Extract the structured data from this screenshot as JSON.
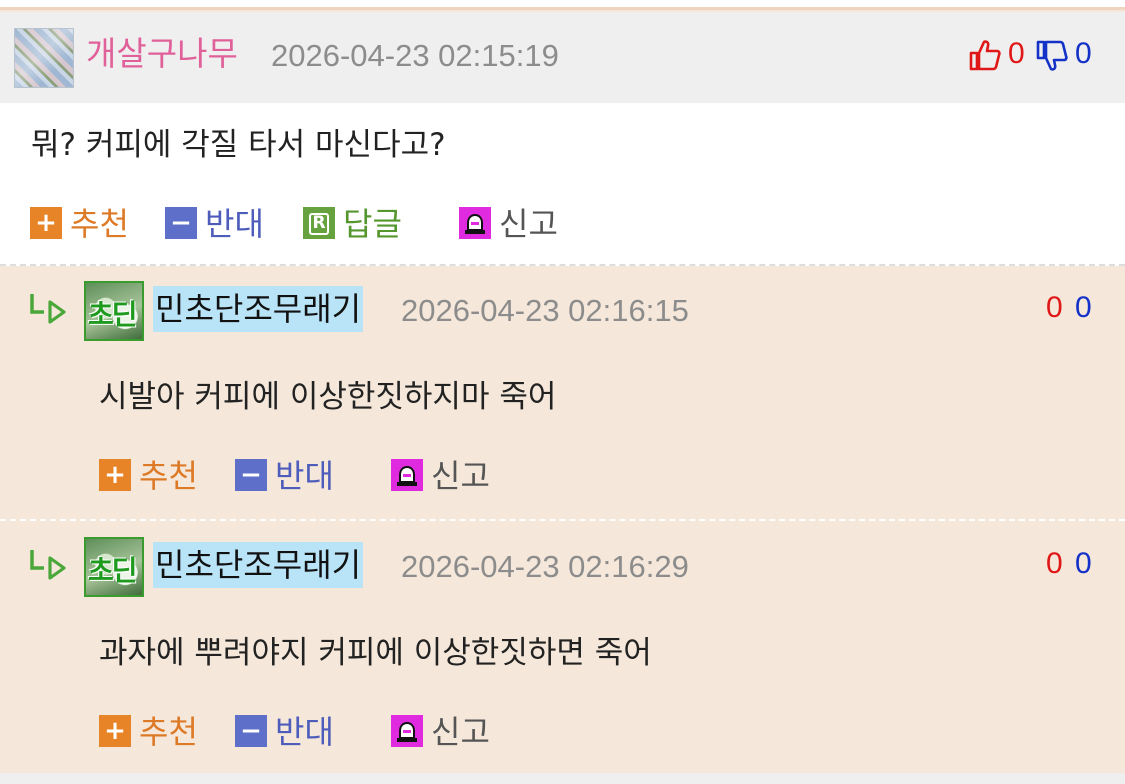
{
  "main_comment": {
    "nickname": "개살구나무",
    "datetime": "2026-04-23 02:15:19",
    "upvotes": "0",
    "downvotes": "0",
    "content": "뭐? 커피에 각질 타서 마신다고?",
    "actions": {
      "recommend": "추천",
      "oppose": "반대",
      "reply": "답글",
      "report": "신고"
    },
    "icons": {
      "recommend": "plus-icon",
      "oppose": "minus-icon",
      "reply": "r-icon",
      "report": "siren-icon"
    }
  },
  "replies": [
    {
      "nickname": "민초단조무래기",
      "avatar_text": "초딘",
      "datetime": "2026-04-23 02:16:15",
      "upvotes": "0",
      "downvotes": "0",
      "content": "시발아 커피에 이상한짓하지마 죽어",
      "actions": {
        "recommend": "추천",
        "oppose": "반대",
        "report": "신고"
      }
    },
    {
      "nickname": "민초단조무래기",
      "avatar_text": "초딘",
      "datetime": "2026-04-23 02:16:29",
      "upvotes": "0",
      "downvotes": "0",
      "content": "과자에 뿌려야지 커피에 이상한짓하면 죽어",
      "actions": {
        "recommend": "추천",
        "oppose": "반대",
        "report": "신고"
      }
    }
  ],
  "colors": {
    "nickname_main": "#e0609a",
    "nickname_reply_bg": "#b9e4f7",
    "upvote": "#e01818",
    "downvote": "#1432c8",
    "reply_bg": "#f5e8da",
    "recommend": "#dd7a27",
    "oppose": "#4e5dbb",
    "reply_action": "#56962e",
    "report_icon": "#e02ae0"
  }
}
